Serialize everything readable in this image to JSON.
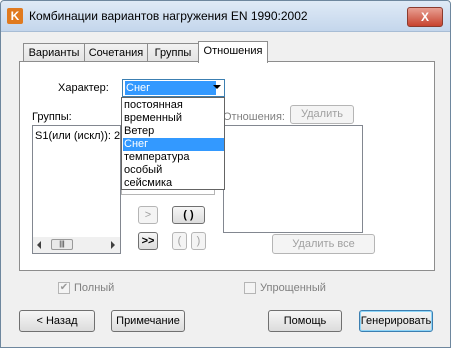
{
  "window": {
    "title": "Комбинации вариантов нагружения EN 1990:2002",
    "app_icon_letter": "K",
    "close_label": "X"
  },
  "tabs": [
    {
      "label": "Варианты",
      "active": false
    },
    {
      "label": "Сочетания",
      "active": false
    },
    {
      "label": "Группы",
      "active": false
    },
    {
      "label": "Отношения",
      "active": true
    }
  ],
  "character": {
    "label": "Характер:",
    "selected": "Снег",
    "options": [
      "постоянная",
      "временный",
      "Ветер",
      "Снег",
      "температура",
      "особый",
      "сейсмика"
    ],
    "selected_index": 3
  },
  "groups": {
    "label": "Группы:",
    "items": [
      "S1(или (искл)): 2"
    ]
  },
  "relations": {
    "label": "Отношения:",
    "delete_label": "Удалить",
    "delete_all_label": "Удалить все"
  },
  "middle_buttons": {
    "add": ">",
    "add_all": ">>",
    "paren_pair": "( )",
    "paren_open": "(",
    "paren_close": ")"
  },
  "checkboxes": {
    "full": {
      "label": "Полный",
      "checked": true
    },
    "simplified": {
      "label": "Упрощенный",
      "checked": false
    }
  },
  "bottom_buttons": {
    "back": "< Назад",
    "note": "Примечание",
    "help": "Помощь",
    "generate": "Генерировать"
  }
}
